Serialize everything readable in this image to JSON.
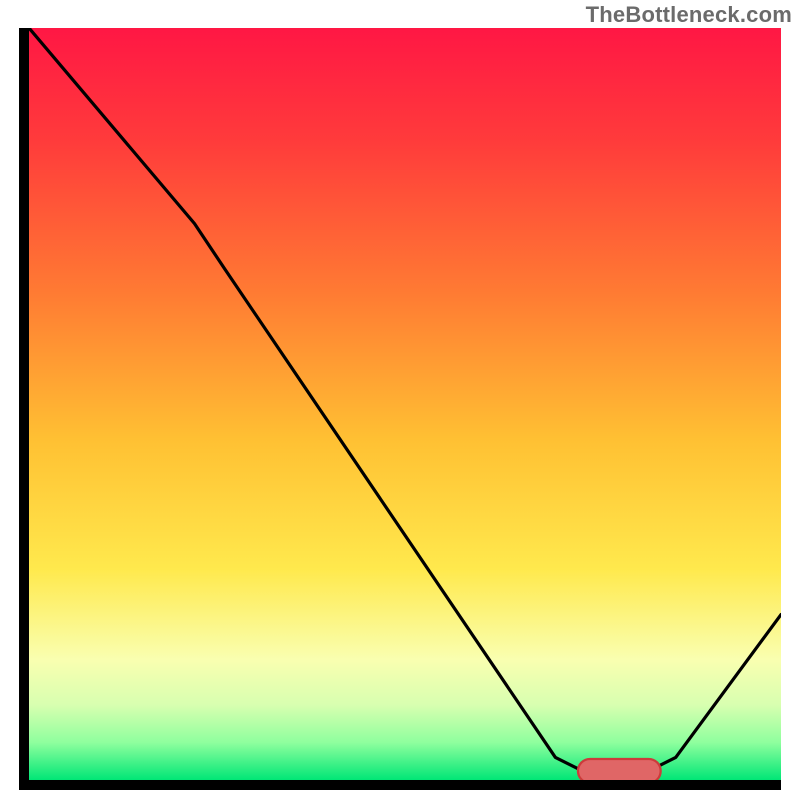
{
  "watermark": "TheBottleneck.com",
  "colors": {
    "axis": "#000000",
    "curve": "#000000",
    "marker_fill": "#e06666",
    "marker_stroke": "#cc3b3b",
    "gradient_stops": [
      {
        "offset": 0.0,
        "color": "#ff1744"
      },
      {
        "offset": 0.15,
        "color": "#ff3b3b"
      },
      {
        "offset": 0.35,
        "color": "#ff7a33"
      },
      {
        "offset": 0.55,
        "color": "#ffc133"
      },
      {
        "offset": 0.72,
        "color": "#ffe94d"
      },
      {
        "offset": 0.84,
        "color": "#f9ffb0"
      },
      {
        "offset": 0.9,
        "color": "#d8ffb0"
      },
      {
        "offset": 0.95,
        "color": "#8fff9e"
      },
      {
        "offset": 1.0,
        "color": "#00e676"
      }
    ]
  },
  "chart_data": {
    "type": "line",
    "title": "",
    "xlabel": "",
    "ylabel": "",
    "xlim": [
      0,
      100
    ],
    "ylim": [
      0,
      100
    ],
    "grid": false,
    "curve_points": [
      {
        "x": 0,
        "y": 100
      },
      {
        "x": 22,
        "y": 74
      },
      {
        "x": 26,
        "y": 68
      },
      {
        "x": 70,
        "y": 3
      },
      {
        "x": 74,
        "y": 1
      },
      {
        "x": 82,
        "y": 1
      },
      {
        "x": 86,
        "y": 3
      },
      {
        "x": 100,
        "y": 22
      }
    ],
    "marker": {
      "x_start": 73,
      "x_end": 84,
      "y": 1.2,
      "radius": 1.6
    },
    "note": "x and y are in percent of the plotting area; y=0 is bottom axis, y=100 is top of colored region."
  }
}
